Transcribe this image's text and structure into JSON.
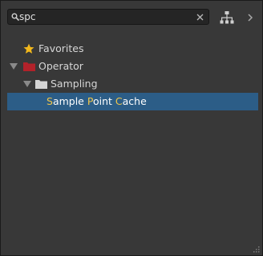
{
  "search": {
    "value": "spc",
    "placeholder": ""
  },
  "toolbar": {
    "icons": {
      "search": "search-icon",
      "clear": "close-icon",
      "hierarchy": "hierarchy-icon",
      "expand": "chevron-right-icon"
    }
  },
  "tree": {
    "favorites": {
      "label": "Favorites",
      "icon": "star-icon"
    },
    "operator": {
      "label": "Operator",
      "icon": "folder-icon",
      "expanded": true
    },
    "sampling": {
      "label": "Sampling",
      "icon": "folder-icon",
      "expanded": true
    },
    "result": {
      "parts": [
        {
          "text": "S",
          "match": true
        },
        {
          "text": "ample ",
          "match": false
        },
        {
          "text": "P",
          "match": true
        },
        {
          "text": "oint ",
          "match": false
        },
        {
          "text": "C",
          "match": true
        },
        {
          "text": "ache",
          "match": false
        }
      ],
      "selected": true
    }
  },
  "colors": {
    "panel": "#383838",
    "selection": "#2c5d87",
    "match_highlight": "#f0c64a",
    "star": "#f2b81c",
    "operator_folder": "#b2222a",
    "sampling_folder": "#d4d4d4"
  }
}
